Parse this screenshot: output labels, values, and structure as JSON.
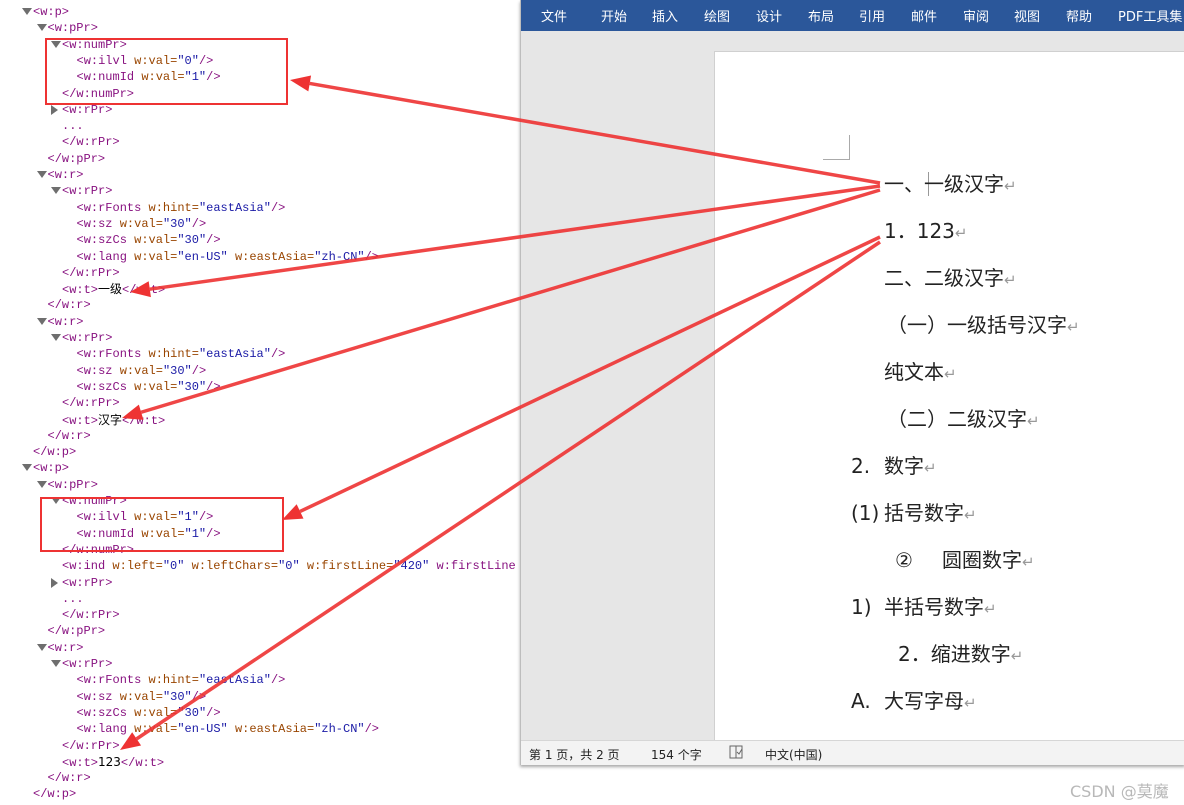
{
  "xml_tree": {
    "lines": [
      {
        "level": 0,
        "toggle": "expanded",
        "text": "<w:p>"
      },
      {
        "level": 1,
        "toggle": "expanded",
        "text": "<w:pPr>"
      },
      {
        "level": 2,
        "toggle": "expanded",
        "text": "<w:numPr>"
      },
      {
        "level": 3,
        "toggle": "none",
        "text": "<w:ilvl w:val=\"0\"/>"
      },
      {
        "level": 3,
        "toggle": "none",
        "text": "<w:numId w:val=\"1\"/>"
      },
      {
        "level": 2,
        "toggle": "none",
        "text": "</w:numPr>"
      },
      {
        "level": 2,
        "toggle": "collapsed",
        "text": "<w:rPr>"
      },
      {
        "level": 2,
        "toggle": "none",
        "text": "..."
      },
      {
        "level": 2,
        "toggle": "none",
        "text": "</w:rPr>"
      },
      {
        "level": 1,
        "toggle": "none",
        "text": "</w:pPr>"
      },
      {
        "level": 1,
        "toggle": "expanded",
        "text": "<w:r>"
      },
      {
        "level": 2,
        "toggle": "expanded",
        "text": "<w:rPr>"
      },
      {
        "level": 3,
        "toggle": "none",
        "text": "<w:rFonts w:hint=\"eastAsia\"/>"
      },
      {
        "level": 3,
        "toggle": "none",
        "text": "<w:sz w:val=\"30\"/>"
      },
      {
        "level": 3,
        "toggle": "none",
        "text": "<w:szCs w:val=\"30\"/>"
      },
      {
        "level": 3,
        "toggle": "none",
        "text": "<w:lang w:val=\"en-US\" w:eastAsia=\"zh-CN\"/>"
      },
      {
        "level": 2,
        "toggle": "none",
        "text": "</w:rPr>"
      },
      {
        "level": 2,
        "toggle": "none",
        "text": "<w:t>一级</w:t>"
      },
      {
        "level": 1,
        "toggle": "none",
        "text": "</w:r>"
      },
      {
        "level": 1,
        "toggle": "expanded",
        "text": "<w:r>"
      },
      {
        "level": 2,
        "toggle": "expanded",
        "text": "<w:rPr>"
      },
      {
        "level": 3,
        "toggle": "none",
        "text": "<w:rFonts w:hint=\"eastAsia\"/>"
      },
      {
        "level": 3,
        "toggle": "none",
        "text": "<w:sz w:val=\"30\"/>"
      },
      {
        "level": 3,
        "toggle": "none",
        "text": "<w:szCs w:val=\"30\"/>"
      },
      {
        "level": 2,
        "toggle": "none",
        "text": "</w:rPr>"
      },
      {
        "level": 2,
        "toggle": "none",
        "text": "<w:t>汉字</w:t>"
      },
      {
        "level": 1,
        "toggle": "none",
        "text": "</w:r>"
      },
      {
        "level": 0,
        "toggle": "none",
        "text": "</w:p>"
      },
      {
        "level": 0,
        "toggle": "expanded",
        "text": "<w:p>"
      },
      {
        "level": 1,
        "toggle": "expanded",
        "text": "<w:pPr>"
      },
      {
        "level": 2,
        "toggle": "expanded",
        "text": "<w:numPr>"
      },
      {
        "level": 3,
        "toggle": "none",
        "text": "<w:ilvl w:val=\"1\"/>"
      },
      {
        "level": 3,
        "toggle": "none",
        "text": "<w:numId w:val=\"1\"/>"
      },
      {
        "level": 2,
        "toggle": "none",
        "text": "</w:numPr>"
      },
      {
        "level": 2,
        "toggle": "none",
        "text": "<w:ind w:left=\"0\" w:leftChars=\"0\" w:firstLine=\"420\" w:firstLine"
      },
      {
        "level": 2,
        "toggle": "collapsed",
        "text": "<w:rPr>"
      },
      {
        "level": 2,
        "toggle": "none",
        "text": "..."
      },
      {
        "level": 2,
        "toggle": "none",
        "text": "</w:rPr>"
      },
      {
        "level": 1,
        "toggle": "none",
        "text": "</w:pPr>"
      },
      {
        "level": 1,
        "toggle": "expanded",
        "text": "<w:r>"
      },
      {
        "level": 2,
        "toggle": "expanded",
        "text": "<w:rPr>"
      },
      {
        "level": 3,
        "toggle": "none",
        "text": "<w:rFonts w:hint=\"eastAsia\"/>"
      },
      {
        "level": 3,
        "toggle": "none",
        "text": "<w:sz w:val=\"30\"/>"
      },
      {
        "level": 3,
        "toggle": "none",
        "text": "<w:szCs w:val=\"30\"/>"
      },
      {
        "level": 3,
        "toggle": "none",
        "text": "<w:lang w:val=\"en-US\" w:eastAsia=\"zh-CN\"/>"
      },
      {
        "level": 2,
        "toggle": "none",
        "text": "</w:rPr>"
      },
      {
        "level": 2,
        "toggle": "none",
        "text": "<w:t>123</w:t>"
      },
      {
        "level": 1,
        "toggle": "none",
        "text": "</w:r>"
      },
      {
        "level": 0,
        "toggle": "none",
        "text": "</w:p>"
      }
    ]
  },
  "word": {
    "ribbon_tabs": [
      "文件",
      "开始",
      "插入",
      "绘图",
      "设计",
      "布局",
      "引用",
      "邮件",
      "审阅",
      "视图",
      "帮助",
      "PDF工具集"
    ],
    "document_lines": [
      {
        "number": "一、",
        "text": "一级汉字"
      },
      {
        "number": "1．",
        "text": "123"
      },
      {
        "number": "二、",
        "text": "二级汉字"
      },
      {
        "number": "（一）",
        "text": "一级括号汉字"
      },
      {
        "number": "",
        "text": "纯文本"
      },
      {
        "number": "（二）",
        "text": "二级汉字"
      },
      {
        "number": "2.",
        "text": "数字"
      },
      {
        "number": "(1)",
        "text": "括号数字"
      },
      {
        "number": "②",
        "text": "圆圈数字"
      },
      {
        "number": "1)",
        "text": "半括号数字"
      },
      {
        "number": "2．",
        "text": "缩进数字"
      },
      {
        "number": "A.",
        "text": "大写字母"
      }
    ],
    "paragraph_mark": "↵",
    "status": {
      "page": "第 1 页，共 2 页",
      "words": "154 个字",
      "proofing_icon": "proofing-check-icon",
      "language": "中文(中国)"
    }
  },
  "watermark": "CSDN @莫魔",
  "colors": {
    "ribbon": "#2b579a",
    "annotation_red": "#ee3333",
    "xml_tag": "#881280",
    "xml_attr_name": "#994500",
    "xml_attr_value": "#1a1aa6"
  }
}
